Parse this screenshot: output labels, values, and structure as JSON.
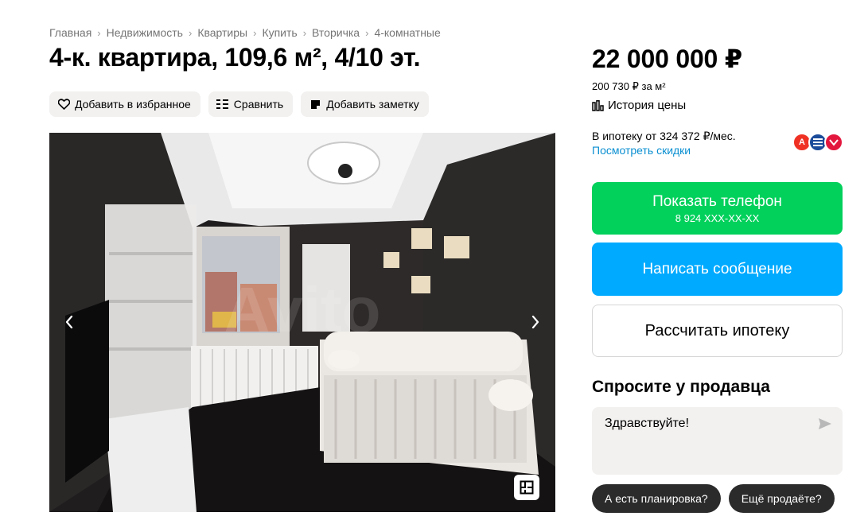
{
  "breadcrumbs": [
    "Главная",
    "Недвижимость",
    "Квартиры",
    "Купить",
    "Вторичка",
    "4-комнатные"
  ],
  "listing": {
    "title": "4-к. квартира, 109,6 м², 4/10 эт."
  },
  "actions": {
    "favorite": {
      "label": "Добавить в избранное",
      "icon": "heart-icon"
    },
    "compare": {
      "label": "Сравнить",
      "icon": "compare-icon"
    },
    "note": {
      "label": "Добавить заметку",
      "icon": "note-icon"
    }
  },
  "gallery": {
    "prev_icon": "chevron-left-icon",
    "next_icon": "chevron-right-icon",
    "plan_icon": "floor-plan-icon",
    "watermark": "Avito"
  },
  "price": {
    "total": "22 000 000 ₽",
    "per_m2": "200 730 ₽ за м²",
    "history_label": "История цены"
  },
  "mortgage": {
    "text": "В ипотеку от 324 372 ₽/мес.",
    "discounts_link": "Посмотреть скидки",
    "bank_logos": [
      {
        "letter": "А",
        "color": "#ef3124"
      },
      {
        "letter": "",
        "color": "#1b4b9a"
      },
      {
        "letter": "",
        "color": "#e3173e"
      }
    ]
  },
  "contact": {
    "show_phone_label": "Показать телефон",
    "phone_masked": "8 924 XXX-XX-XX",
    "write_message_label": "Написать сообщение",
    "calc_mortgage_label": "Рассчитать ипотеку"
  },
  "ask_seller": {
    "title": "Спросите у продавца",
    "input_value": "Здравствуйте!",
    "chips": [
      "А есть планировка?",
      "Ещё продаёте?"
    ]
  },
  "colors": {
    "green": "#02d15c",
    "blue": "#00aaff",
    "link": "#0a8fd1",
    "chip_bg": "#2b2b2b",
    "button_bg": "#f2f1f0"
  }
}
